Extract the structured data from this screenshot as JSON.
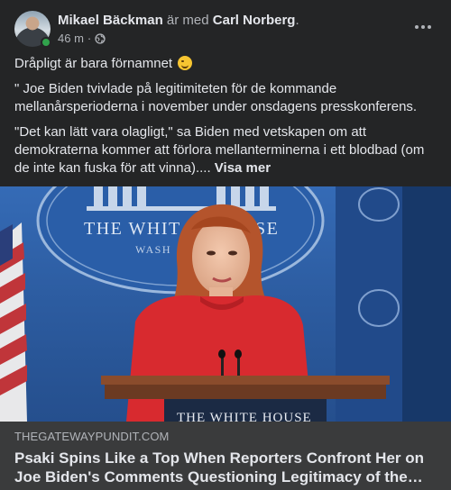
{
  "author": {
    "name": "Mikael Bäckman",
    "with_text": " är med ",
    "tagged": "Carl Norberg",
    "suffix": "."
  },
  "timestamp": "46 m",
  "separator": "·",
  "privacy_icon": "globe-icon",
  "post": {
    "line1": "Dråpligt är bara förnamnet ",
    "quote1": "\" Joe Biden tvivlade på legitimiteten för de kommande mellanårsperioderna i november under onsdagens presskonferens.",
    "quote2": "\"Det kan lätt vara olagligt,\" sa Biden med vetskapen om att demokraterna kommer att förlora mellanterminerna i ett blodbad (om de inte kan fuska för att vinna)....",
    "see_more": "Visa mer"
  },
  "photo": {
    "seal_text": "THE WHIT",
    "seal_text_right": "SE",
    "seal_sub": "WASH",
    "podium_text": "THE WHITE HOUSE"
  },
  "link": {
    "domain": "THEGATEWAYPUNDIT.COM",
    "headline": "Psaki Spins Like a Top When Reporters Confront Her on Joe Biden's Comments Questioning Legitimacy of the Upcoming Midterms"
  },
  "colors": {
    "background": "#242526",
    "link_box": "#3a3b3c",
    "online": "#31a24c"
  }
}
